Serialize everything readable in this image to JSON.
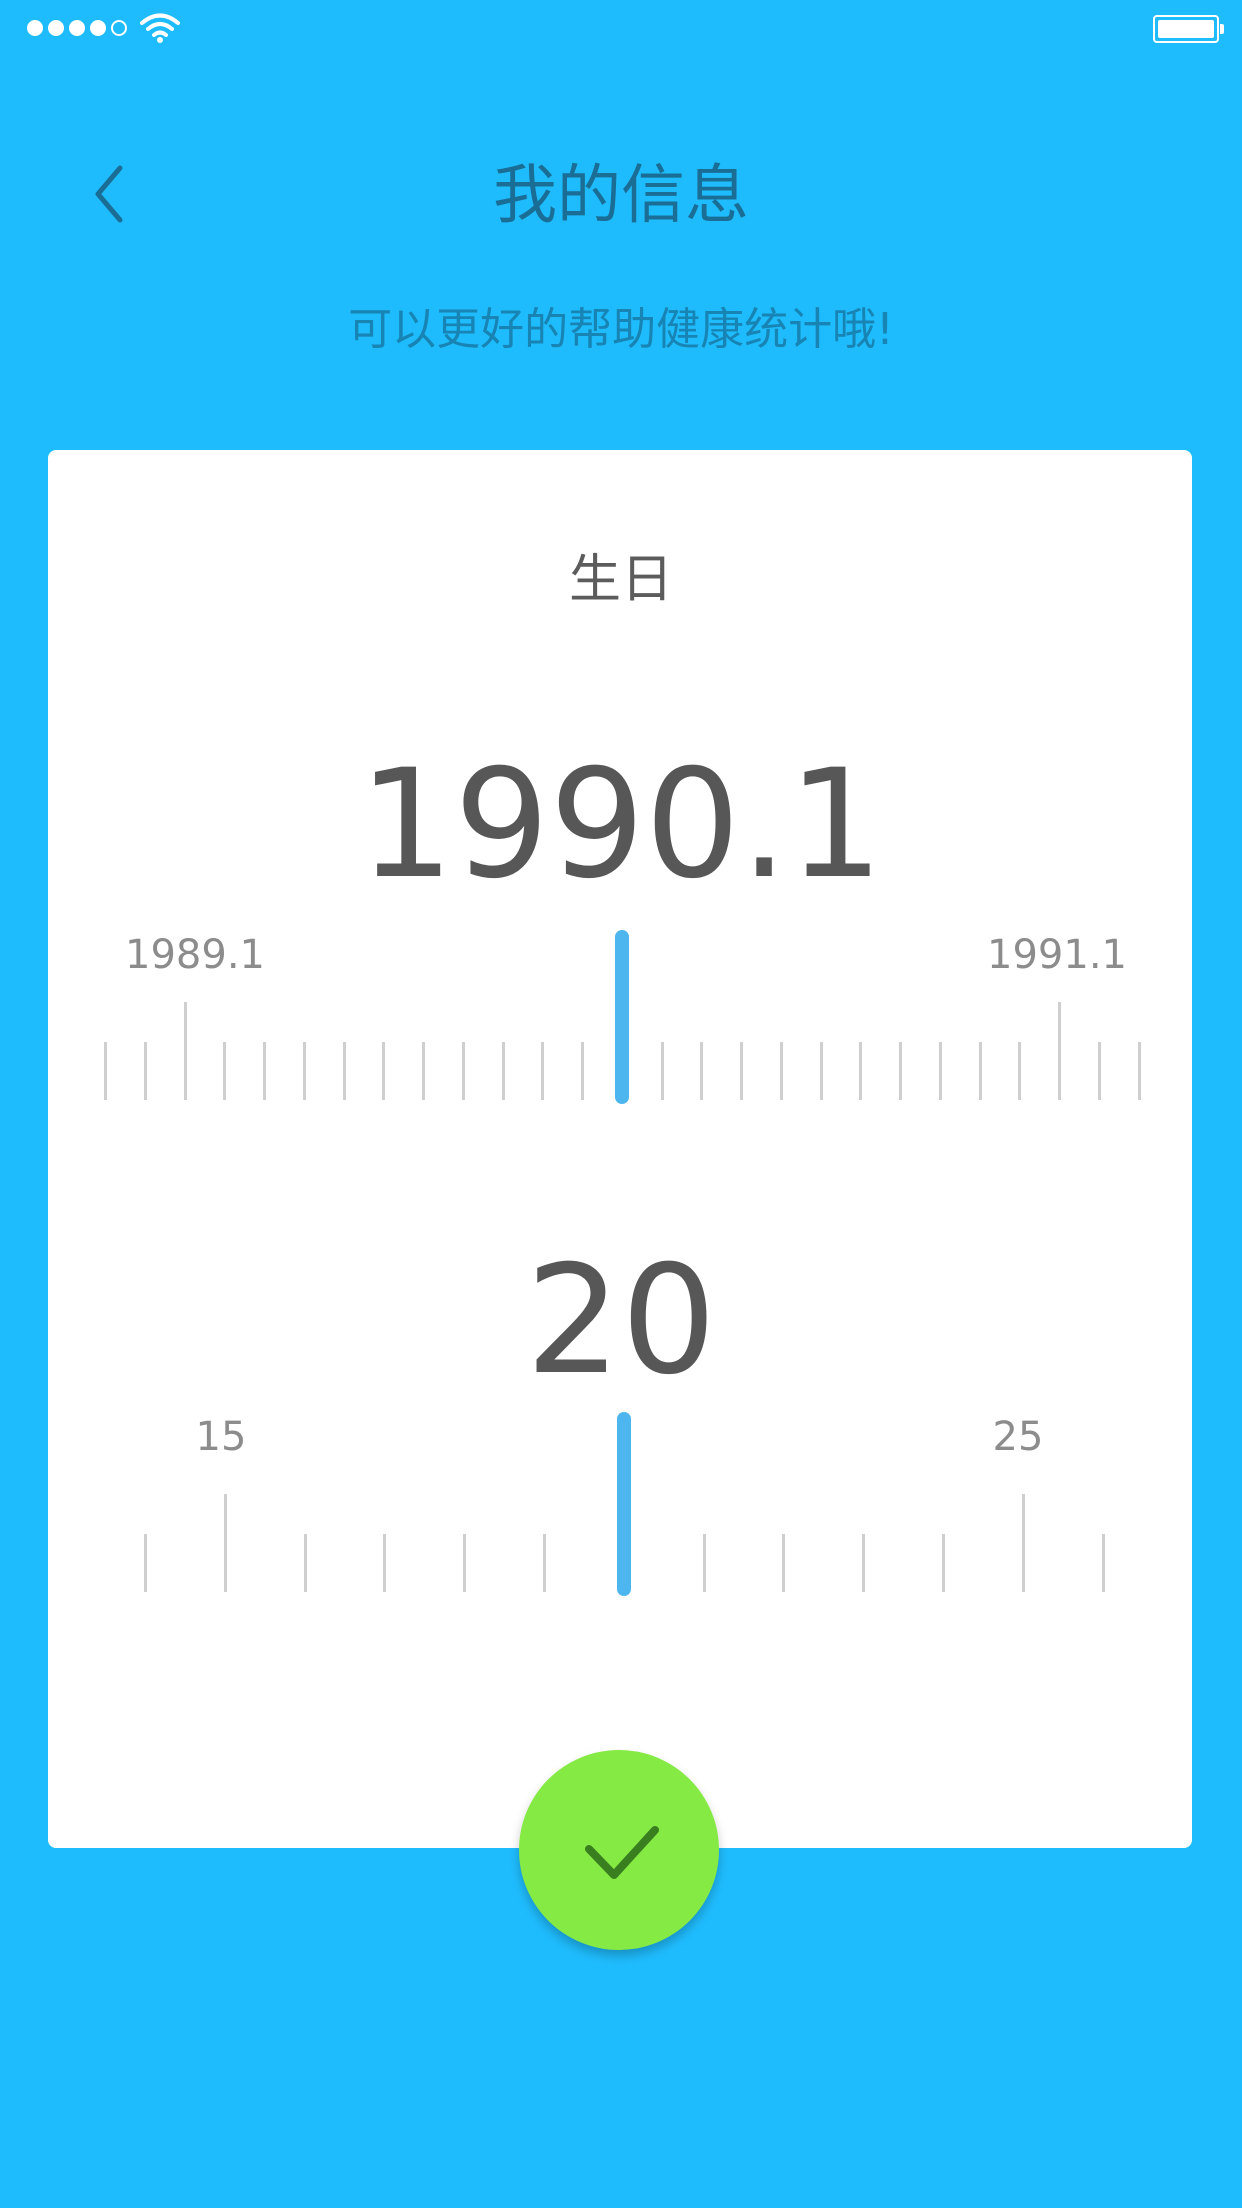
{
  "status_bar": {
    "signal_strength": "4 of 5",
    "wifi_icon": "wifi-icon",
    "battery_level": 0.9,
    "color": "#ffffff"
  },
  "header": {
    "back_icon": "chevron-left-icon",
    "title": "我的信息",
    "subtitle": "可以更好的帮助健康统计哦!"
  },
  "card": {
    "birthday": {
      "label": "生日",
      "value": "1990.1",
      "ruler": {
        "left_label": "1989.1",
        "right_label": "1991.1",
        "selected": "1990.1",
        "indicator_color": "#4db6ee"
      }
    },
    "age": {
      "value": "20",
      "ruler": {
        "left_label": "15",
        "right_label": "25",
        "selected": 20,
        "indicator_color": "#4db6ee"
      }
    }
  },
  "confirm": {
    "icon": "check-icon",
    "color": "#86ea45"
  },
  "colors": {
    "background": "#1fbcfd",
    "card": "#ffffff",
    "text_dark": "#575757",
    "accent": "#4db6ee"
  }
}
